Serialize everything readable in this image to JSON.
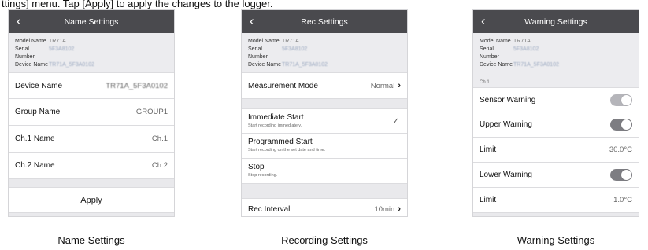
{
  "top_caption": "ttings] menu. Tap [Apply] to apply the changes to the logger.",
  "name_settings": {
    "title": "Name Settings",
    "info": {
      "model_label": "Model Name",
      "model_value": "TR71A",
      "serial_label": "Serial Number",
      "serial_value": "5F3A8102",
      "device_label": "Device Name",
      "device_value": "TR71A_5F3A0102"
    },
    "rows": [
      {
        "label": "Device Name",
        "value": "TR71A_5F3A0102"
      },
      {
        "label": "Group Name",
        "value": "GROUP1"
      },
      {
        "label": "Ch.1 Name",
        "value": "Ch.1"
      },
      {
        "label": "Ch.2 Name",
        "value": "Ch.2"
      }
    ],
    "apply_label": "Apply",
    "caption": "Name Settings"
  },
  "rec_settings": {
    "title": "Rec Settings",
    "info": {
      "model_label": "Model Name",
      "model_value": "TR71A",
      "serial_label": "Serial Number",
      "serial_value": "5F3A8102",
      "device_label": "Device Name",
      "device_value": "TR71A_5F3A0102"
    },
    "measurement_mode_label": "Measurement Mode",
    "measurement_mode_value": "Normal",
    "options": [
      {
        "title": "Immediate Start",
        "sub": "Start recording immediately.",
        "checked": true
      },
      {
        "title": "Programmed Start",
        "sub": "Start recording on the set date and time.",
        "checked": false
      },
      {
        "title": "Stop",
        "sub": "Stop recording.",
        "checked": false
      }
    ],
    "rec_interval_label": "Rec Interval",
    "rec_interval_value": "10min",
    "caption": "Recording Settings"
  },
  "warning_settings": {
    "title": "Warning Settings",
    "info": {
      "model_label": "Model Name",
      "model_value": "TR71A",
      "serial_label": "Serial Number",
      "serial_value": "5F3A8102",
      "device_label": "Device Name",
      "device_value": "TR71A_5F3A0102"
    },
    "section_label": "Ch.1",
    "sensor_warning_label": "Sensor Warning",
    "sensor_warning_on": true,
    "upper_warning_label": "Upper Warning",
    "upper_warning_on": true,
    "upper_limit_label": "Limit",
    "upper_limit_value": "30.0°C",
    "lower_warning_label": "Lower Warning",
    "lower_warning_on": true,
    "lower_limit_label": "Limit",
    "lower_limit_value": "1.0°C",
    "caption": "Warning Settings"
  },
  "icons": {
    "back": "chevron-left-icon",
    "forward": "chevron-right-icon",
    "check": "checkmark-icon"
  },
  "colors": {
    "nav_bar": "#4a4a4e",
    "toggle_on": "#7d7d82",
    "background": "#e9e9ec"
  }
}
